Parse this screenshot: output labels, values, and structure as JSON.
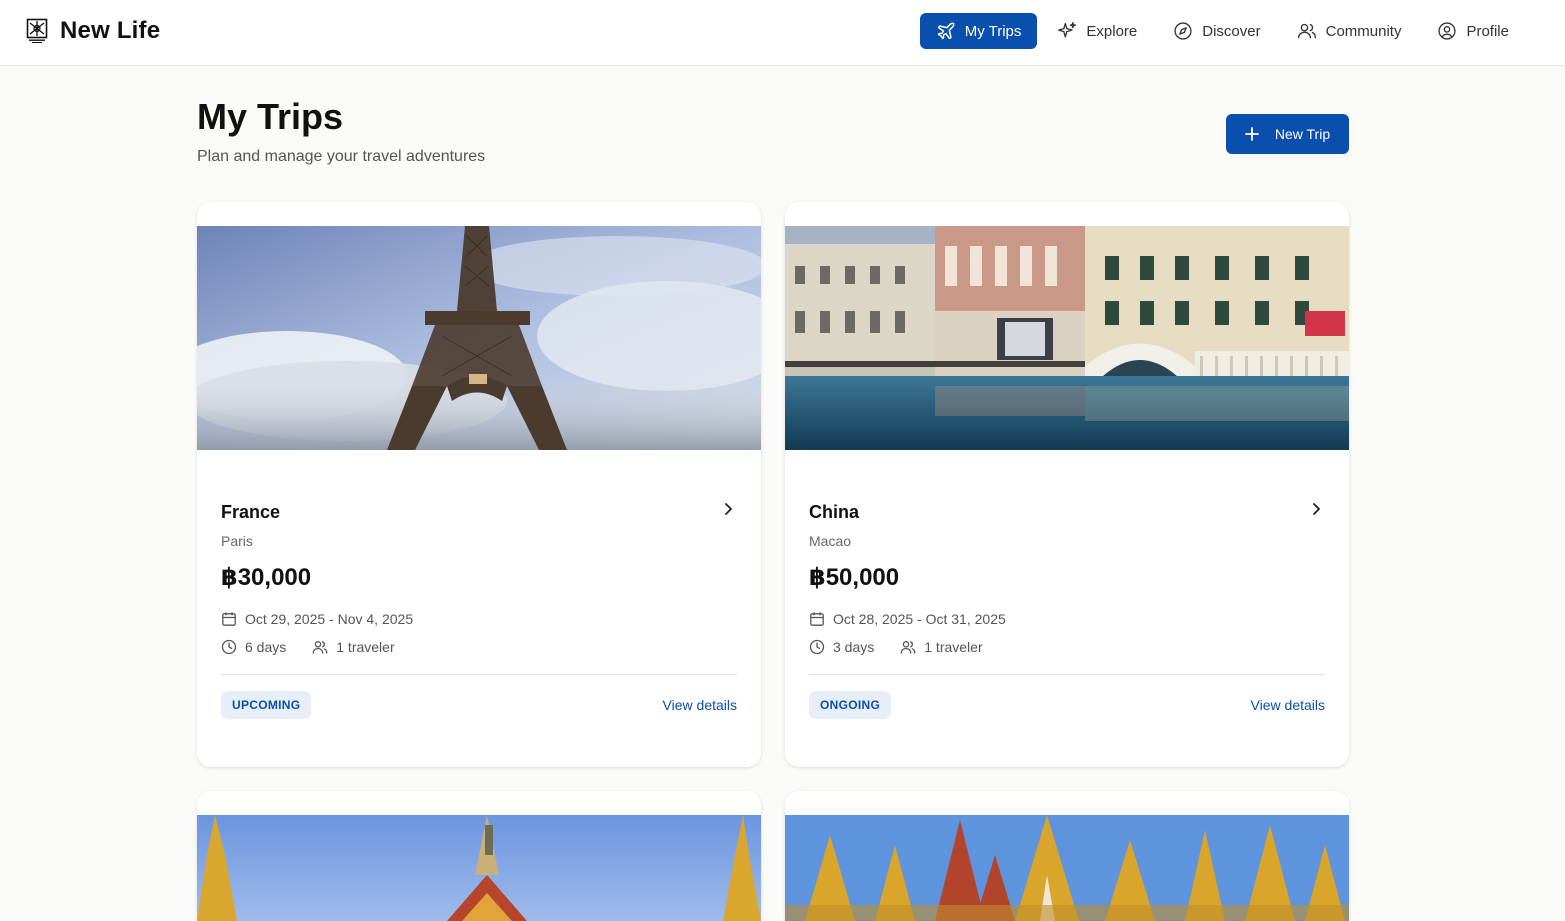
{
  "app": {
    "name": "New Life"
  },
  "nav": [
    {
      "label": "My Trips",
      "icon": "plane-icon",
      "active": true
    },
    {
      "label": "Explore",
      "icon": "sparkles-icon",
      "active": false
    },
    {
      "label": "Discover",
      "icon": "compass-icon",
      "active": false
    },
    {
      "label": "Community",
      "icon": "users-icon",
      "active": false
    },
    {
      "label": "Profile",
      "icon": "user-circle-icon",
      "active": false
    }
  ],
  "page": {
    "title": "My Trips",
    "subtitle": "Plan and manage your travel adventures",
    "new_trip_label": "New Trip"
  },
  "trips": [
    {
      "country": "France",
      "city": "Paris",
      "price": "฿30,000",
      "dates": "Oct 29, 2025 - Nov 4, 2025",
      "duration": "6 days",
      "travelers": "1 traveler",
      "status": "UPCOMING",
      "details_label": "View details"
    },
    {
      "country": "China",
      "city": "Macao",
      "price": "฿50,000",
      "dates": "Oct 28, 2025 - Oct 31, 2025",
      "duration": "3 days",
      "travelers": "1 traveler",
      "status": "ONGOING",
      "details_label": "View details"
    }
  ],
  "colors": {
    "primary": "#0a4fae",
    "badge_bg": "#e7eef8",
    "page_bg": "#fafaf7"
  }
}
